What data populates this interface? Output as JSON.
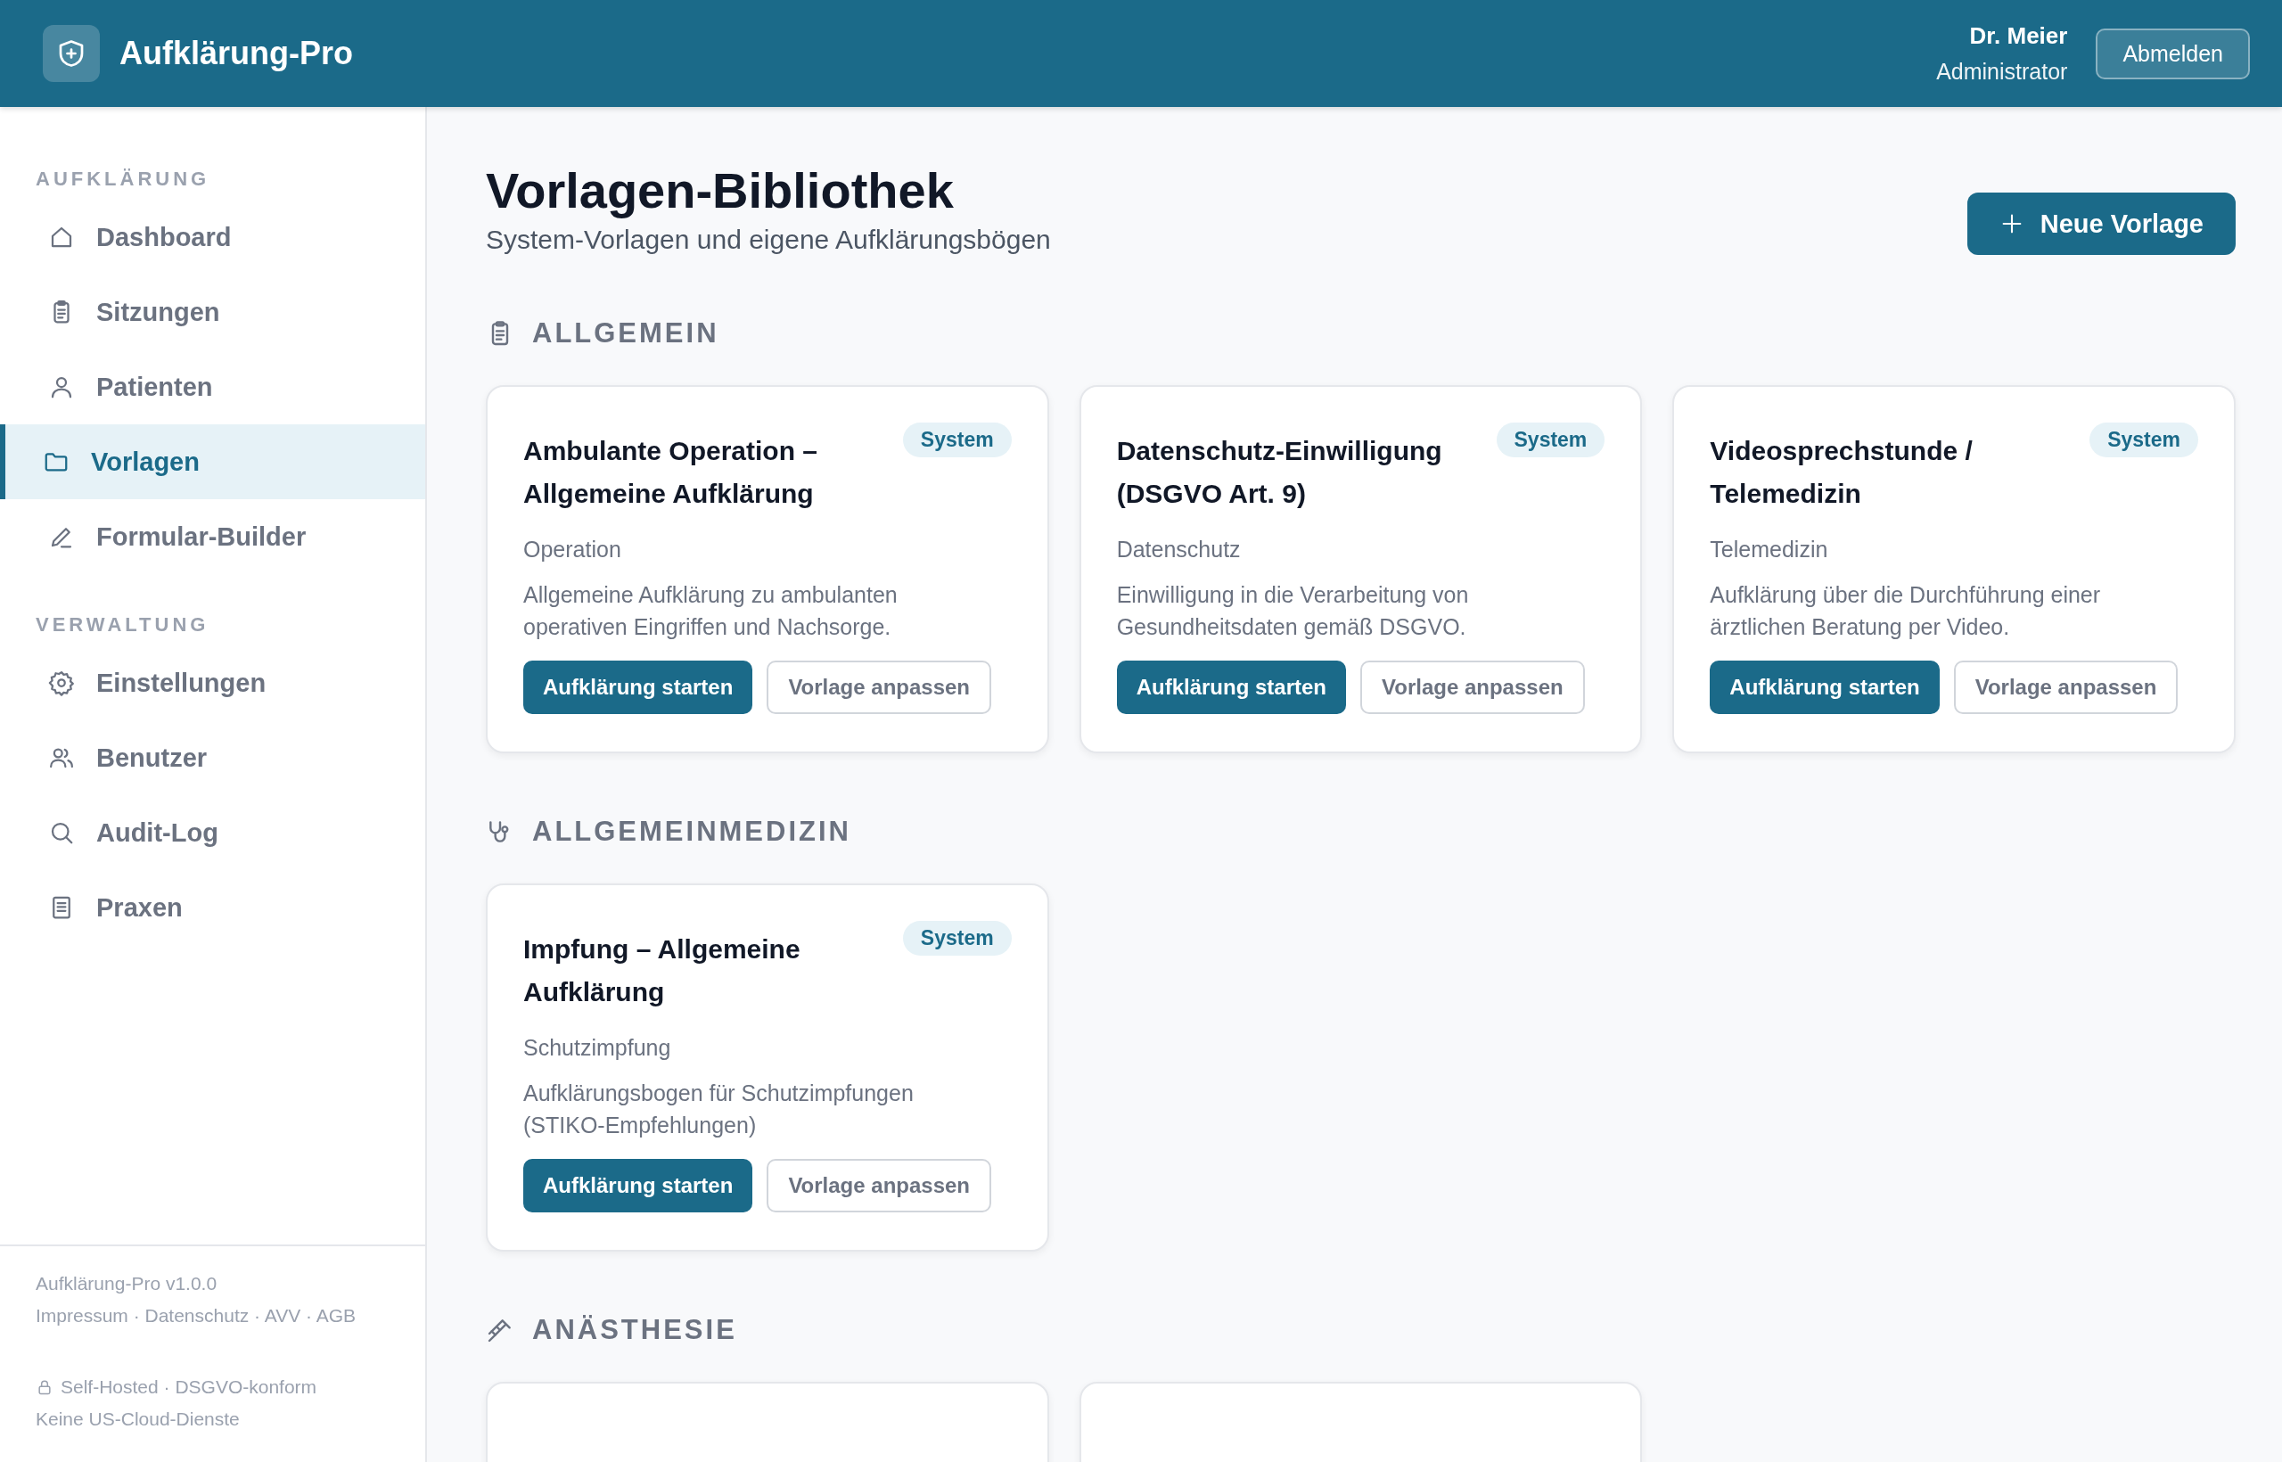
{
  "app": {
    "name": "Aufklärung-Pro"
  },
  "user": {
    "name": "Dr. Meier",
    "role": "Administrator",
    "logout": "Abmelden"
  },
  "sidebar": {
    "groups": [
      {
        "label": "AUFKLÄRUNG",
        "items": [
          {
            "label": "Dashboard",
            "selected": false
          },
          {
            "label": "Sitzungen",
            "selected": false
          },
          {
            "label": "Patienten",
            "selected": false
          },
          {
            "label": "Vorlagen",
            "selected": true
          },
          {
            "label": "Formular-Builder",
            "selected": false
          }
        ]
      },
      {
        "label": "VERWALTUNG",
        "items": [
          {
            "label": "Einstellungen",
            "selected": false
          },
          {
            "label": "Benutzer",
            "selected": false
          },
          {
            "label": "Audit-Log",
            "selected": false
          },
          {
            "label": "Praxen",
            "selected": false
          }
        ]
      }
    ],
    "footer": {
      "version": "Aufklärung-Pro v1.0.0",
      "links": "Impressum · Datenschutz · AVV · AGB",
      "hosting": "Self-Hosted · DSGVO-konform",
      "note": "Keine US-Cloud-Dienste"
    }
  },
  "page": {
    "title": "Vorlagen-Bibliothek",
    "subtitle": "System-Vorlagen und eigene Aufklärungsbögen",
    "new_button": "Neue Vorlage"
  },
  "sections": [
    {
      "title": "ALLGEMEIN",
      "templates": [
        {
          "kind": "card",
          "title": "Ambulante Operation – Allgemeine Aufklärung",
          "badge": "System",
          "category": "Operation",
          "description": "Allgemeine Aufklärung zu ambulanten operativen Eingriffen und Nachsorge.",
          "actions": [
            "Aufklärung starten",
            "Vorlage anpassen"
          ]
        },
        {
          "kind": "card",
          "title": "Datenschutz-Einwilligung (DSGVO Art. 9)",
          "badge": "System",
          "category": "Datenschutz",
          "description": "Einwilligung in die Verarbeitung von Gesundheitsdaten gemäß DSGVO.",
          "actions": [
            "Aufklärung starten",
            "Vorlage anpassen"
          ]
        },
        {
          "kind": "card",
          "title": "Videosprechstunde / Telemedizin",
          "badge": "System",
          "category": "Telemedizin",
          "description": "Aufklärung über die Durchführung einer ärztlichen Beratung per Video.",
          "actions": [
            "Aufklärung starten",
            "Vorlage anpassen"
          ]
        }
      ]
    },
    {
      "title": "ALLGEMEINMEDIZIN",
      "templates": [
        {
          "kind": "card",
          "title": "Impfung – Allgemeine Aufklärung",
          "badge": "System",
          "category": "Schutzimpfung",
          "description": "Aufklärungsbogen für Schutzimpfungen (STIKO-Empfehlungen)",
          "actions": [
            "Aufklärung starten",
            "Vorlage anpassen"
          ]
        }
      ]
    },
    {
      "title": "ANÄSTHESIE",
      "templates": [
        {
          "kind": "cut"
        },
        {
          "kind": "cut"
        }
      ]
    }
  ]
}
